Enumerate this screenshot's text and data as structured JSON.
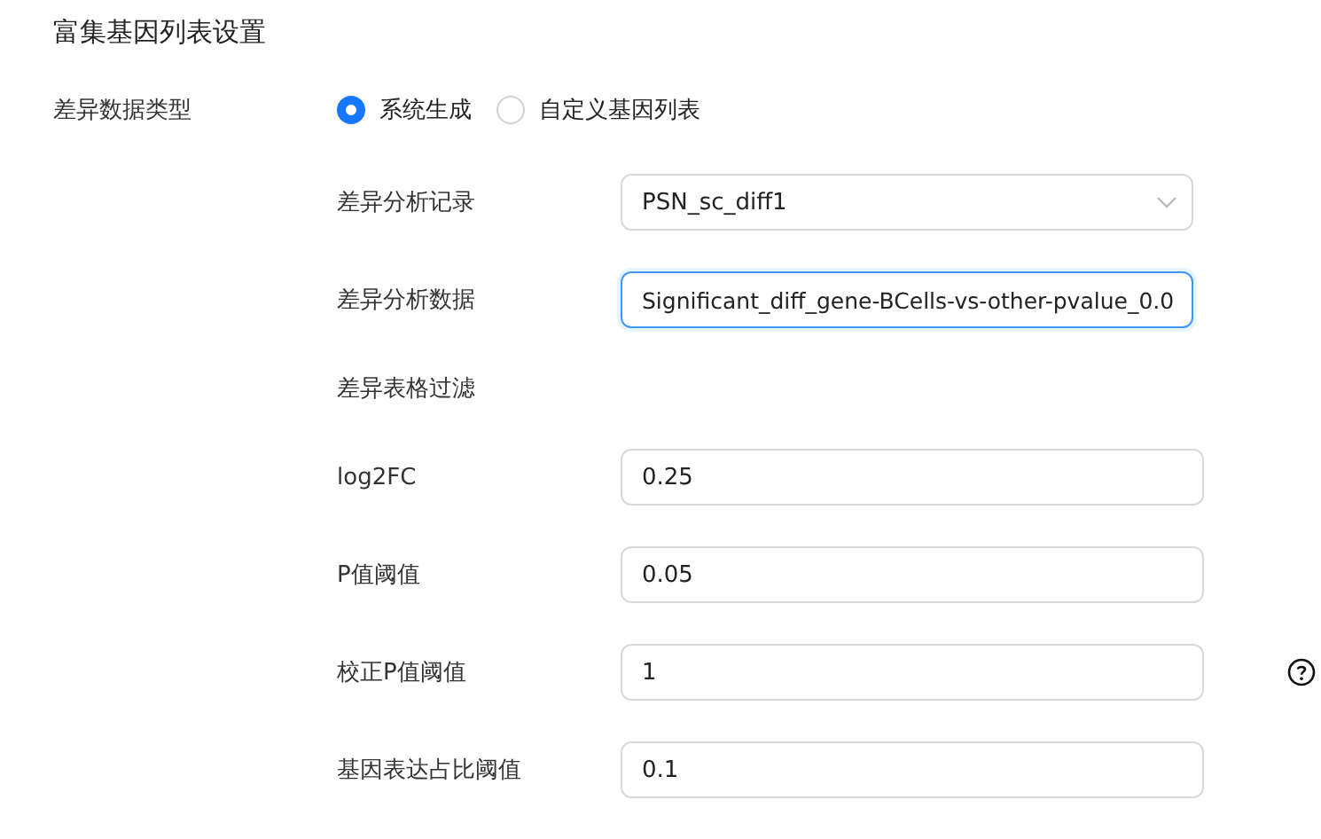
{
  "section_title": "富集基因列表设置",
  "data_type": {
    "label": "差异数据类型",
    "options": [
      {
        "label": "系统生成",
        "selected": true
      },
      {
        "label": "自定义基因列表",
        "selected": false
      }
    ]
  },
  "fields": [
    {
      "kind": "select",
      "label": "差异分析记录",
      "value": "PSN_sc_diff1"
    },
    {
      "kind": "text",
      "label": "差异分析数据",
      "value": "Significant_diff_gene-BCells-vs-other-pvalue_0.0",
      "focused": true
    },
    {
      "kind": "heading",
      "label": "差异表格过滤"
    },
    {
      "kind": "number",
      "label": "log2FC",
      "value": "0.25"
    },
    {
      "kind": "number",
      "label": "P值阈值",
      "value": "0.05"
    },
    {
      "kind": "number",
      "label": "校正P值阈值",
      "value": "1",
      "help": true
    },
    {
      "kind": "number",
      "label": "基因表达占比阈值",
      "value": "0.1"
    }
  ]
}
